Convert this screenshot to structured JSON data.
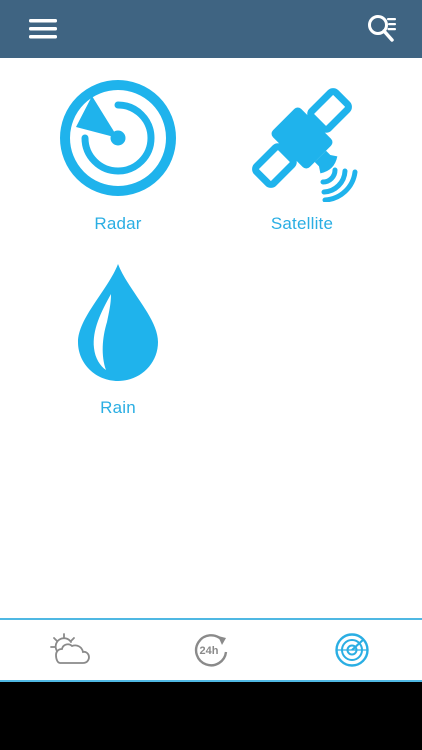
{
  "header": {
    "background_color": "#3f6482",
    "menu_icon": "hamburger-menu-icon",
    "search_icon": "search-list-icon"
  },
  "tiles": [
    {
      "label": "Radar",
      "icon": "radar-icon"
    },
    {
      "label": "Satellite",
      "icon": "satellite-icon"
    },
    {
      "label": "Rain",
      "icon": "raindrop-icon"
    }
  ],
  "tabbar": {
    "tabs": [
      {
        "icon": "partly-cloudy-icon",
        "active": false
      },
      {
        "icon": "24h-forecast-icon",
        "icon_text": "24h",
        "active": false
      },
      {
        "icon": "radar-tab-icon",
        "active": true
      }
    ]
  },
  "colors": {
    "accent": "#2aaee3",
    "header": "#3f6482",
    "inactive_icon": "#8a8a8a"
  }
}
